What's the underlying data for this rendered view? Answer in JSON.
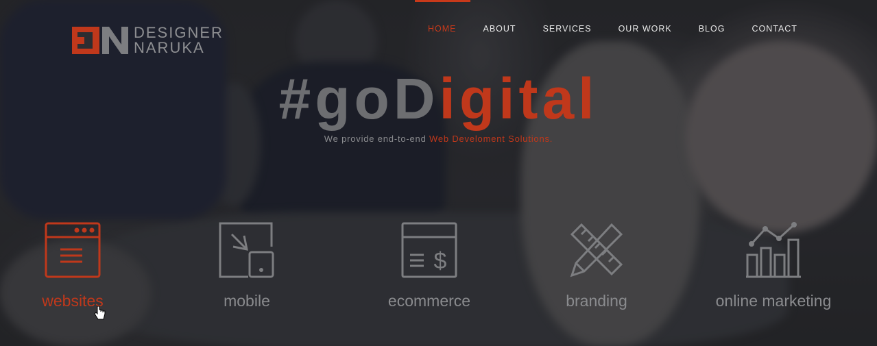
{
  "brand": {
    "name_line1": "DESIGNER",
    "name_line2": "NARUKA",
    "accent_color": "#c0381b"
  },
  "nav": {
    "items": [
      {
        "label": "HOME",
        "active": true
      },
      {
        "label": "ABOUT"
      },
      {
        "label": "SERVICES"
      },
      {
        "label": "OUR WORK"
      },
      {
        "label": "BLOG"
      },
      {
        "label": "CONTACT"
      }
    ]
  },
  "hero": {
    "title_part1": "#go",
    "title_part2": "D",
    "title_part3": "igital",
    "subtitle_lead": "We provide end-to-end ",
    "subtitle_accent": "Web Develoment Solutions."
  },
  "services": [
    {
      "label": "websites",
      "icon": "browser-window-icon",
      "active": true
    },
    {
      "label": "mobile",
      "icon": "responsive-devices-icon"
    },
    {
      "label": "ecommerce",
      "icon": "payment-window-icon"
    },
    {
      "label": "branding",
      "icon": "pencil-ruler-icon"
    },
    {
      "label": "online marketing",
      "icon": "growth-chart-icon"
    }
  ]
}
